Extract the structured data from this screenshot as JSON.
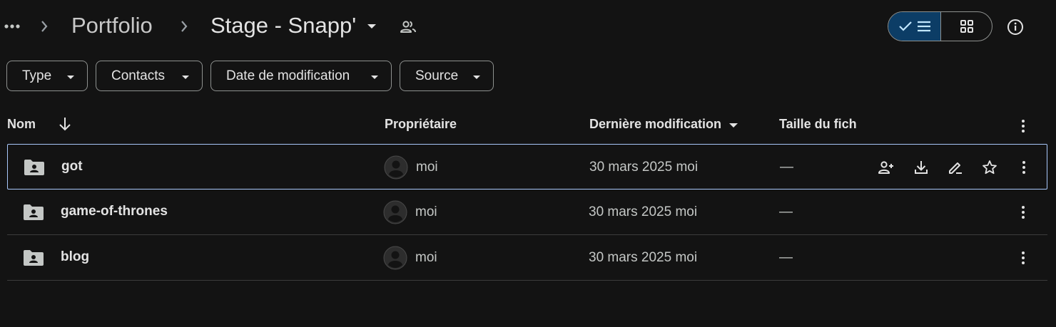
{
  "breadcrumb": {
    "parent": "Portfolio",
    "current": "Stage - Snapp'"
  },
  "filters": [
    {
      "label": "Type"
    },
    {
      "label": "Contacts"
    },
    {
      "label": "Date de modification"
    },
    {
      "label": "Source"
    }
  ],
  "table": {
    "columns": {
      "name": "Nom",
      "owner": "Propriétaire",
      "modified": "Dernière modification",
      "size": "Taille du fich"
    },
    "rows": [
      {
        "name": "got",
        "owner": "moi",
        "modified_date": "30 mars 2025",
        "modified_by": "moi",
        "size": "—",
        "selected": true
      },
      {
        "name": "game-of-thrones",
        "owner": "moi",
        "modified_date": "30 mars 2025",
        "modified_by": "moi",
        "size": "—",
        "selected": false
      },
      {
        "name": "blog",
        "owner": "moi",
        "modified_date": "30 mars 2025",
        "modified_by": "moi",
        "size": "—",
        "selected": false
      }
    ]
  },
  "icons": {
    "breadcrumb_more": "more-horiz-icon",
    "separator": "chevron-right-icon",
    "breadcrumb_menu": "caret-down-icon",
    "shared": "people-icon",
    "view_list": "checklist-view-icon",
    "view_grid": "grid-view-icon",
    "info": "info-icon",
    "sort": "arrow-down-icon",
    "folder": "shared-folder-icon",
    "row_actions": [
      "share-icon",
      "download-icon",
      "rename-icon",
      "star-icon",
      "more-vert-icon"
    ]
  },
  "colors": {
    "background": "#131313",
    "accent_selected_view": "#0c3d66",
    "selection_border": "#a8c7fa",
    "text_primary": "#e3e3e3",
    "text_secondary": "#c4c7c5"
  }
}
